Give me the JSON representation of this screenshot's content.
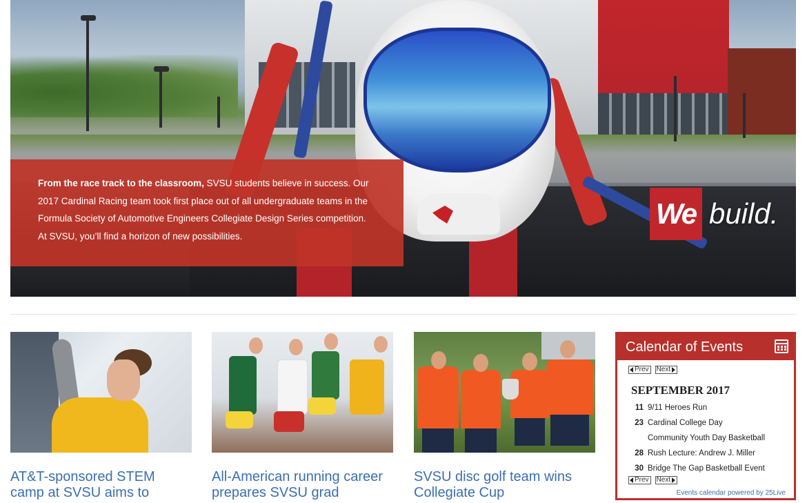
{
  "hero": {
    "caption_lead": "From the race track to the classroom,",
    "caption_body": " SVSU students believe in success. Our 2017 Cardinal Racing team took first place out of all undergraduate teams in the Formula Society of Automotive Engineers Collegiate Design Series competition. At SVSU, you’ll find a horizon of new possibilities.",
    "slogan_we": "We",
    "slogan_rest": "build."
  },
  "news": [
    {
      "headline": "AT&T-sponsored STEM camp at SVSU aims to"
    },
    {
      "headline": "All-American running career prepares SVSU grad"
    },
    {
      "headline": "SVSU disc golf team wins Collegiate Cup"
    }
  ],
  "calendar": {
    "title": "Calendar of Events",
    "icon": "calendar-icon",
    "prev_label": "Prev",
    "next_label": "Next",
    "month": "SEPTEMBER 2017",
    "events": [
      {
        "day": "11",
        "title": "9/11 Heroes Run"
      },
      {
        "day": "23",
        "title": "Cardinal College Day"
      },
      {
        "day": "",
        "title": "Community Youth Day Basketball"
      },
      {
        "day": "28",
        "title": "Rush Lecture: Andrew J. Miller"
      },
      {
        "day": "30",
        "title": "Bridge The Gap Basketball Event"
      }
    ],
    "footer": "Events calendar powered by 25Live"
  },
  "colors": {
    "brand_red": "#b8302c",
    "link_blue": "#3a6fb0"
  }
}
